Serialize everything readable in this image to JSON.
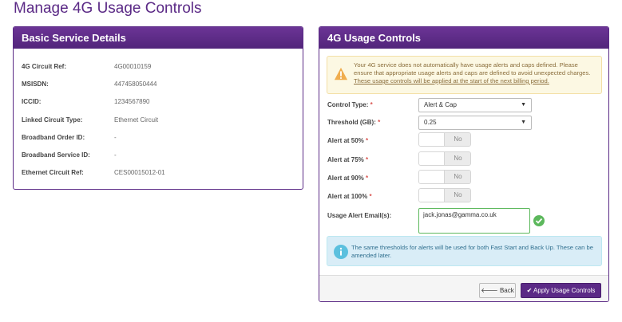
{
  "page": {
    "title": "Manage 4G Usage Controls"
  },
  "basic": {
    "header": "Basic Service Details",
    "rows": [
      {
        "label": "4G Circuit Ref:",
        "value": "4G00010159"
      },
      {
        "label": "MSISDN:",
        "value": "447458050444"
      },
      {
        "label": "ICCID:",
        "value": "1234567890"
      },
      {
        "label": "Linked Circuit Type:",
        "value": "Ethernet Circuit"
      },
      {
        "label": "Broadband Order ID:",
        "value": "-"
      },
      {
        "label": "Broadband Service ID:",
        "value": "-"
      },
      {
        "label": "Ethernet Circuit Ref:",
        "value": "CES00015012-01"
      }
    ]
  },
  "usage": {
    "header": "4G Usage Controls",
    "warning_text": "Your 4G service does not automatically have usage alerts and caps defined. Please ensure that appropriate usage alerts and caps are defined to avoid unexpected charges.",
    "warning_link": "These usage controls will be applied at the start of the next billing period.",
    "control_type": {
      "label": "Control Type:",
      "value": "Alert & Cap"
    },
    "threshold": {
      "label": "Threshold (GB):",
      "value": "0.25"
    },
    "alerts": [
      {
        "label": "Alert at 50%",
        "state": "No"
      },
      {
        "label": "Alert at 75%",
        "state": "No"
      },
      {
        "label": "Alert at 90%",
        "state": "No"
      },
      {
        "label": "Alert at 100%",
        "state": "No"
      }
    ],
    "email": {
      "label": "Usage Alert Email(s):",
      "value": "jack.jonas@gamma.co.uk"
    },
    "info_text": "The same thresholds for alerts will be used for both Fast Start and Back Up. These can be amended later.",
    "required_mark": "*",
    "back_label": "Back",
    "apply_label": "Apply Usage Controls"
  },
  "colors": {
    "brand": "#5b2a86",
    "warning_bg": "#fcf8e3",
    "info_bg": "#d9edf7",
    "success": "#5cb85c"
  },
  "icons": [
    "warning-icon",
    "chevron-down-icon",
    "check-circle-icon",
    "info-icon",
    "arrow-left-icon",
    "check-icon"
  ]
}
